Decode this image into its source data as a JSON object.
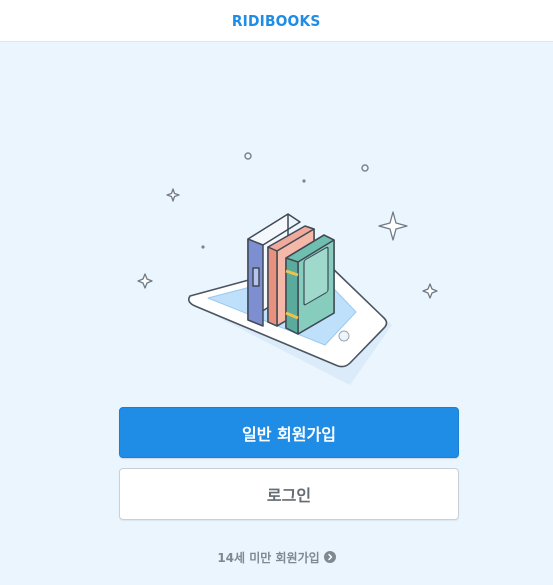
{
  "header": {
    "logo_text": "RIDIBOOKS"
  },
  "illustration": {
    "icon": "books-on-tablet-illustration"
  },
  "actions": {
    "signup_label": "일반 회원가입",
    "login_label": "로그인",
    "under14_label": "14세 미만 회원가입",
    "under14_icon": "chevron-right-circle-icon"
  },
  "colors": {
    "brand": "#1f8ce6",
    "background": "#eaf5fe",
    "muted_text": "#808991"
  }
}
